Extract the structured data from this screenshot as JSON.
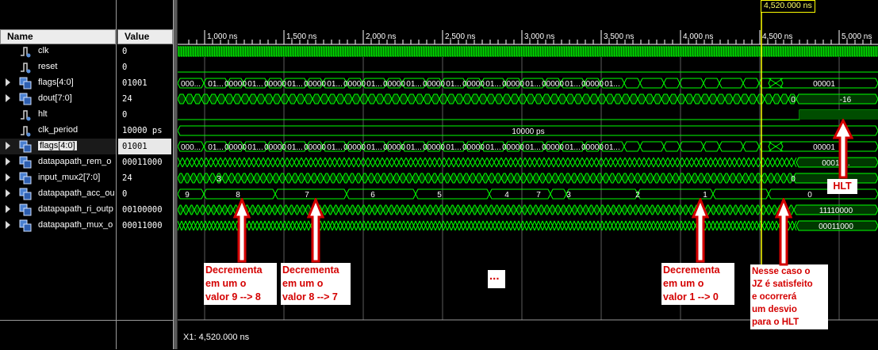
{
  "headers": {
    "name": "Name",
    "value": "Value"
  },
  "signals": [
    {
      "name": "clk",
      "value": "0",
      "icon": "bit-signal-icon",
      "expandable": false
    },
    {
      "name": "reset",
      "value": "0",
      "icon": "bit-signal-icon",
      "expandable": false
    },
    {
      "name": "flags[4:0]",
      "value": "01001",
      "icon": "bus-signal-icon",
      "expandable": true
    },
    {
      "name": "dout[7:0]",
      "value": "24",
      "icon": "bus-signal-icon",
      "expandable": true
    },
    {
      "name": "hlt",
      "value": "0",
      "icon": "bit-signal-icon",
      "expandable": false
    },
    {
      "name": "clk_period",
      "value": "10000 ps",
      "icon": "bit-signal-icon",
      "expandable": false
    },
    {
      "name": "flags[4:0]",
      "value": "01001",
      "icon": "bus-signal-icon",
      "expandable": true,
      "selected": true
    },
    {
      "name": "datapapath_rem_o",
      "value": "00011000",
      "icon": "bus-signal-icon",
      "expandable": true
    },
    {
      "name": "input_mux2[7:0]",
      "value": "24",
      "icon": "bus-signal-icon",
      "expandable": true
    },
    {
      "name": "datapapath_acc_ou",
      "value": "0",
      "icon": "bus-signal-icon",
      "expandable": true
    },
    {
      "name": "datapapath_ri_outp",
      "value": "00100000",
      "icon": "bus-signal-icon",
      "expandable": true
    },
    {
      "name": "datapapath_mux_o",
      "value": "00011000",
      "icon": "bus-signal-icon",
      "expandable": true
    }
  ],
  "timeline": {
    "ticks": [
      "1,000 ns",
      "1,500 ns",
      "2,000 ns",
      "2,500 ns",
      "3,000 ns",
      "3,500 ns",
      "4,000 ns",
      "4,500 ns",
      "5,000 ns"
    ],
    "cursor_label": "4,520.000 ns",
    "status": "X1: 4,520.000 ns"
  },
  "wave_labels": {
    "flags_segments": [
      "000...",
      "01...",
      "00000",
      "01...",
      "00000",
      "01...",
      "00000",
      "01...",
      "00000",
      "01...",
      "00000",
      "01...",
      "00000",
      "01...",
      "00000",
      "01...",
      "00000",
      "01...",
      "00000",
      "01...",
      "00000",
      "01..."
    ],
    "flags_final": "00001",
    "dout_tail": "0",
    "dout_final": "-16",
    "clk_period_text": "10000 ps",
    "flags2_final": "00001",
    "rem_final": "00011...",
    "mux2_mid": "3",
    "mux2_tail": "0",
    "acc_values": [
      "9",
      "8",
      "7",
      "6",
      "5",
      "4",
      "7",
      "3",
      "2",
      "1",
      "0"
    ],
    "ri_final": "11110000",
    "mux_final": "00011000"
  },
  "annotations": {
    "dec_9_8": "Decrementa\nem um o\nvalor 9 --> 8",
    "dec_8_7": "Decrementa\nem um o\nvalor 8 --> 7",
    "ellipsis": "...",
    "dec_1_0": "Decrementa\nem um o\nvalor 1 --> 0",
    "jz_note": "Nesse caso o\nJZ é satisfeito\ne ocorrerá\num desvio\npara o HLT",
    "hlt": "HLT"
  },
  "colors": {
    "wave": "#00ff00",
    "wave_fill": "#00c000",
    "grid": "#5c5c5c",
    "cursor": "#ffff00",
    "annotation_text": "#d40000"
  }
}
